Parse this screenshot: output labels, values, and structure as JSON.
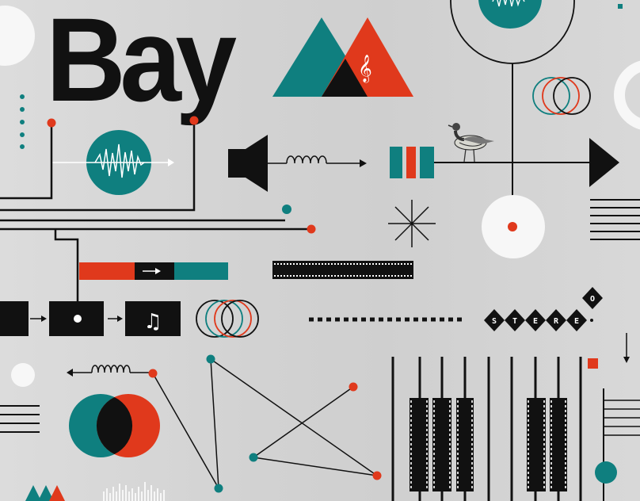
{
  "poster": {
    "title": "Bay",
    "stereo_letters": [
      "S",
      "T",
      "E",
      "R",
      "E",
      "O"
    ]
  },
  "palette": {
    "teal": "#0f7f7f",
    "red": "#e0391c",
    "black": "#111111",
    "background": "#d4d4d4",
    "white": "#f7f7f7"
  },
  "icons": [
    "triangle-logo-icon",
    "treble-clef-icon",
    "waveform-icon",
    "speaker-icon",
    "music-note-icon",
    "bird-icon",
    "asterisk-icon",
    "play-arrow-icon"
  ]
}
